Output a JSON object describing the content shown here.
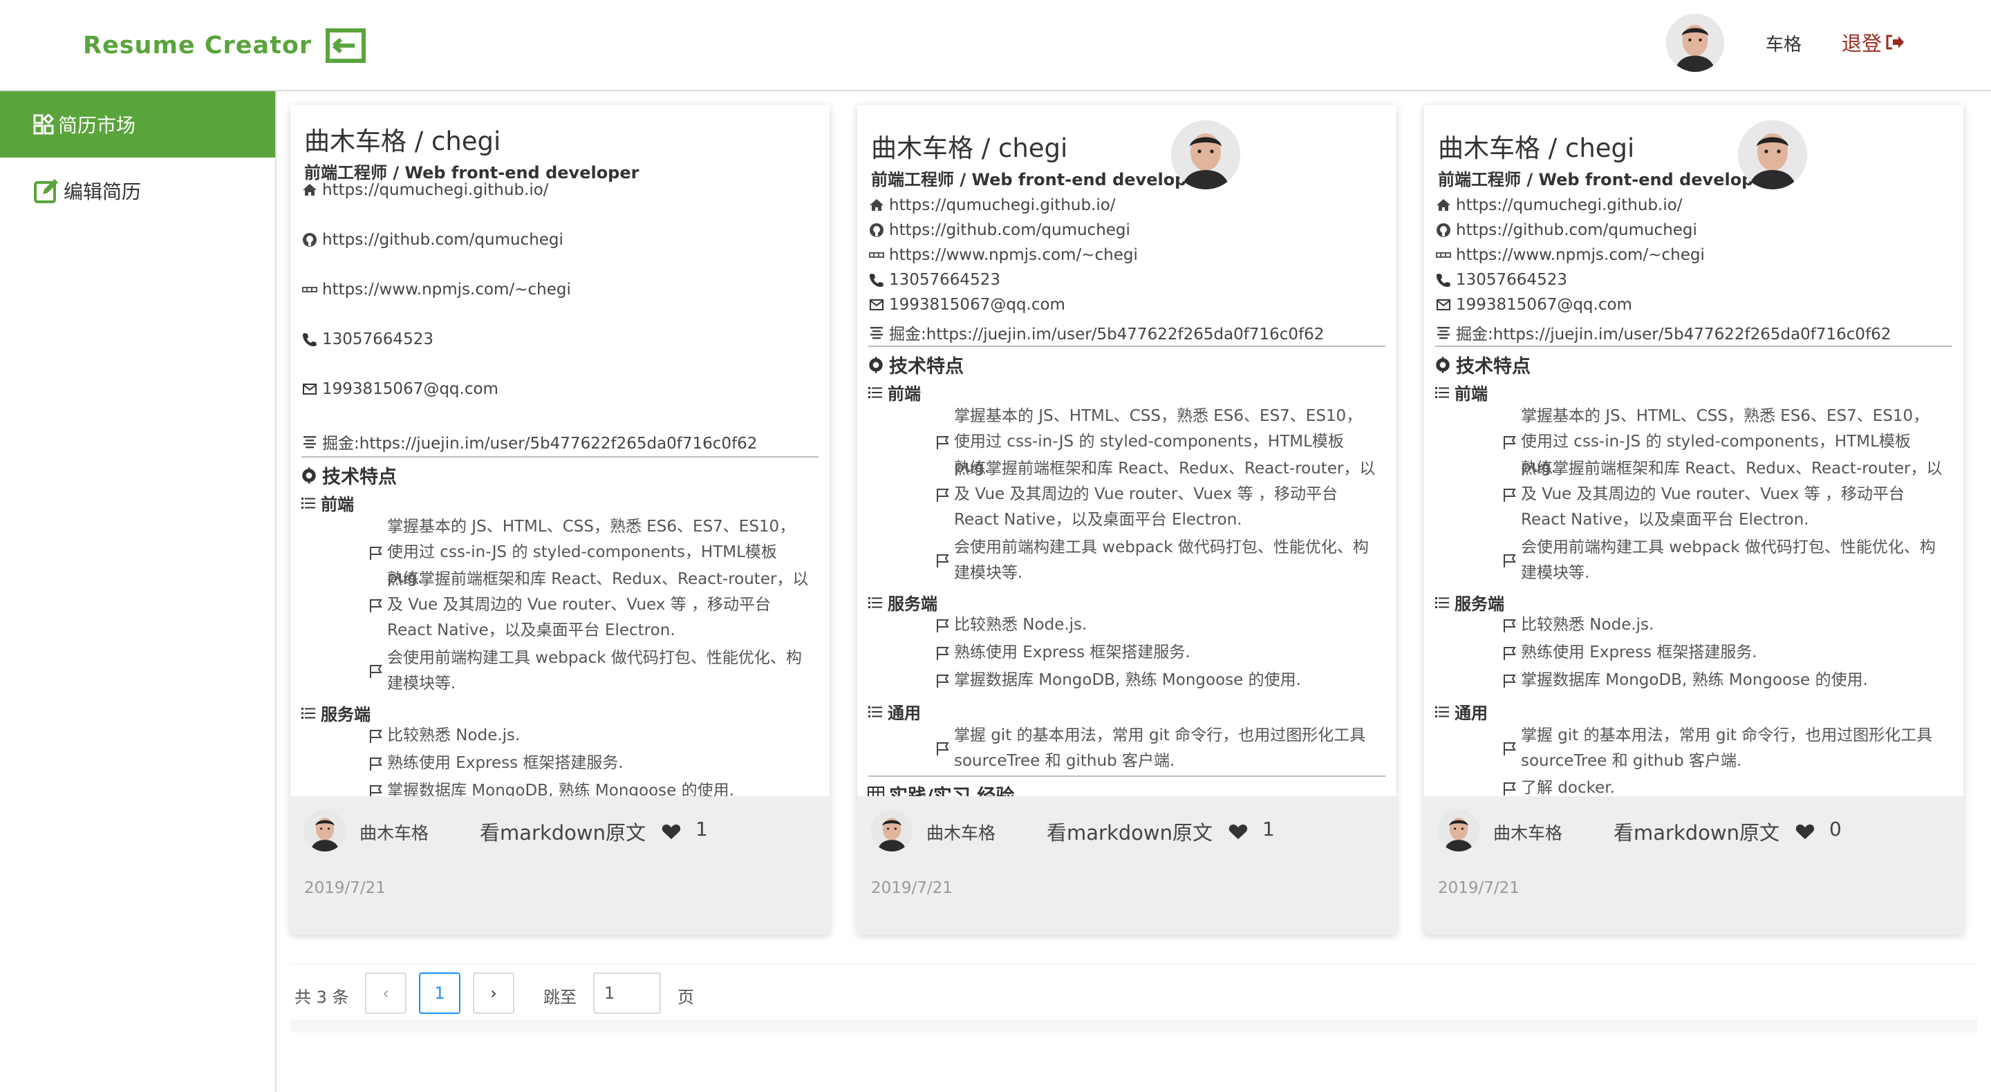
{
  "header": {
    "brand": "Resume Creator",
    "user_name": "车格",
    "logout_label": "退登"
  },
  "sidebar": {
    "items": [
      {
        "label": "简历市场",
        "icon": "market-grid-icon",
        "active": true
      },
      {
        "label": "编辑简历",
        "icon": "edit-icon",
        "active": false
      }
    ]
  },
  "resume": {
    "name": "曲木车格 / chegi",
    "title": "前端工程师 / Web front-end developer",
    "homepage": "https://qumuchegi.github.io/",
    "github": "https://github.com/qumuchegi",
    "npm": "https://www.npmjs.com/~chegi",
    "phone": "13057664523",
    "email": "1993815067@qq.com",
    "juejin": "掘金:https://juejin.im/user/5b477622f265da0f716c0f62",
    "skills_heading": "技术特点",
    "frontend_heading": "前端",
    "frontend_items": [
      "掌握基本的 JS、HTML、CSS，熟悉 ES6、ES7、ES10，使用过 css-in-JS 的 styled-components，HTML模板 pug.",
      "熟练掌握前端框架和库 React、Redux、React-router，以及 Vue 及其周边的 Vue router、Vuex 等 ，移动平台 React Native，以及桌面平台 Electron.",
      "会使用前端构建工具 webpack 做代码打包、性能优化、构建模块等."
    ],
    "backend_heading": "服务端",
    "backend_items": [
      "比较熟悉 Node.js.",
      "熟练使用 Express 框架搭建服务.",
      "掌握数据库 MongoDB, 熟练 Mongoose 的使用."
    ],
    "general_heading": "通用",
    "general_items": [
      "掌握 git 的基本用法，常用 git 命令行，也用过图形化工具 sourceTree 和 github 客户端.",
      "了解 docker."
    ],
    "experience_heading": "实践/实习 经验"
  },
  "cards": [
    {
      "author": "曲木车格",
      "markdown_link": "看markdown原文",
      "likes": "1",
      "date": "2019/7/21"
    },
    {
      "author": "曲木车格",
      "markdown_link": "看markdown原文",
      "likes": "1",
      "date": "2019/7/21"
    },
    {
      "author": "曲木车格",
      "markdown_link": "看markdown原文",
      "likes": "0",
      "date": "2019/7/21"
    }
  ],
  "pagination": {
    "total": "共 3 条",
    "prev": "‹",
    "current_page": "1",
    "next": "›",
    "jump_label": "跳至",
    "jump_value": "1",
    "page_label": "页"
  },
  "colors": {
    "brand_green": "#5aa43c",
    "logout_red": "#9b2a20",
    "pager_blue": "#1890ff"
  }
}
